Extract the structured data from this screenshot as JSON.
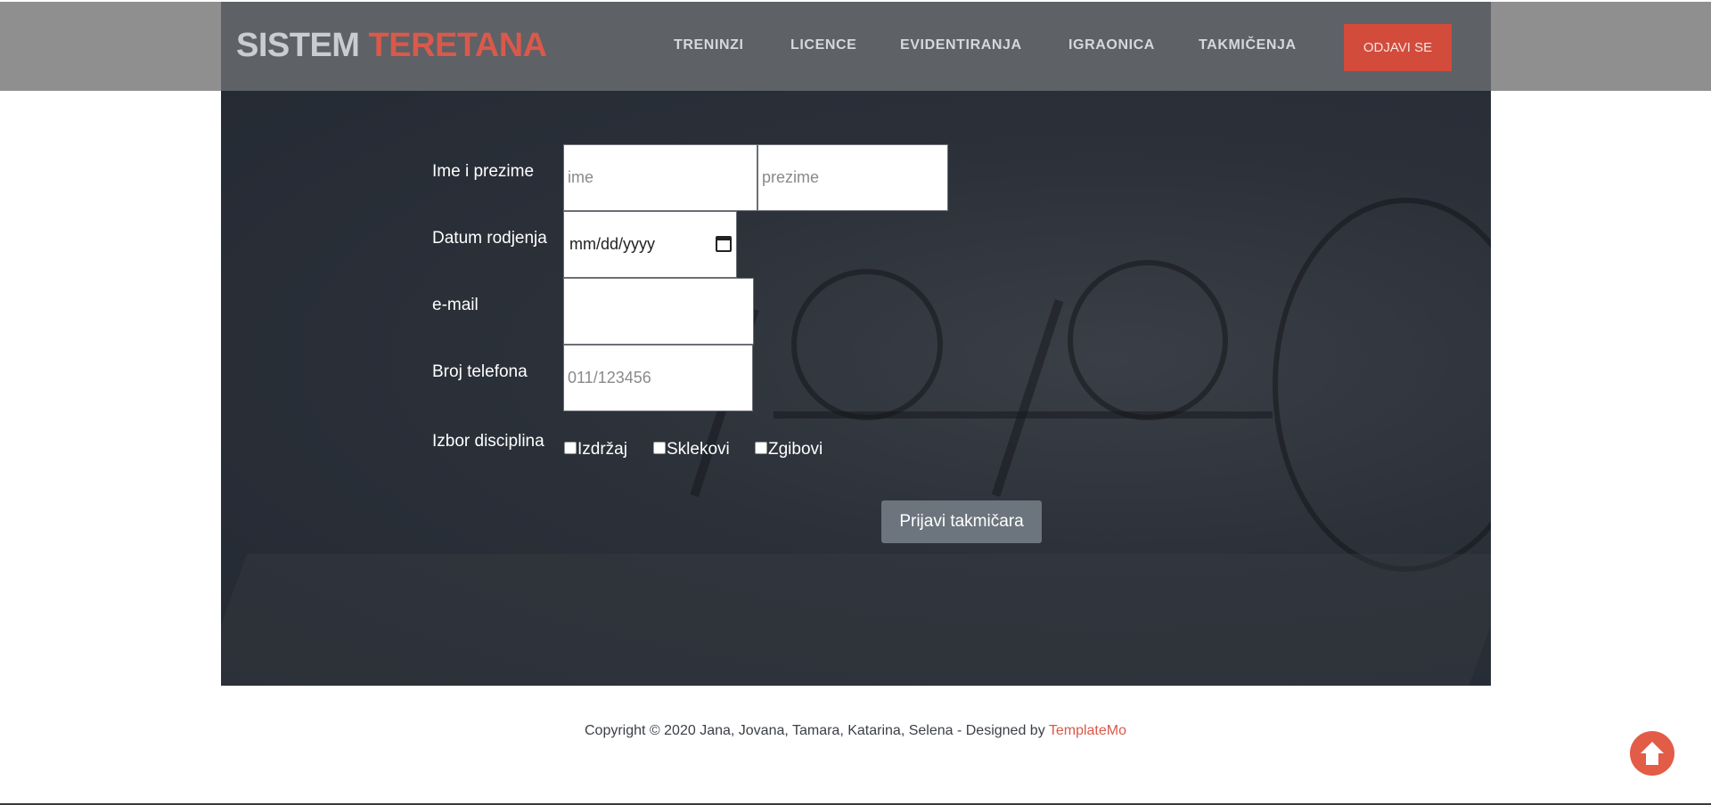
{
  "header": {
    "logo_part1": "SISTEM",
    "logo_part2": "TERETANA",
    "nav": [
      "TRENINZI",
      "LICENCE",
      "EVIDENTIRANJA",
      "IGRAONICA",
      "TAKMIČENJA"
    ],
    "logout_label": "ODJAVI SE"
  },
  "form": {
    "name_label": "Ime i prezime",
    "first_name_placeholder": "ime",
    "last_name_placeholder": "prezime",
    "dob_label": "Datum rodjenja",
    "dob_placeholder": "mm/dd/yyyy",
    "email_label": "e-mail",
    "phone_label": "Broj telefona",
    "phone_placeholder": "011/123456",
    "disciplines_label": "Izbor disciplina",
    "disciplines": [
      "Izdržaj",
      "Sklekovi",
      "Zgibovi"
    ],
    "submit_label": "Prijavi takmičara"
  },
  "footer": {
    "text": "Copyright © 2020 Jana, Jovana, Tamara, Katarina, Selena - Designed by",
    "link": "TemplateMo"
  },
  "icons": {
    "scroll_top": "arrow-up-circle-icon",
    "calendar": "calendar-icon"
  },
  "colors": {
    "accent": "#d9594a",
    "header": "#5e6166",
    "hero": "#2b3039",
    "submit": "#6c757d"
  }
}
